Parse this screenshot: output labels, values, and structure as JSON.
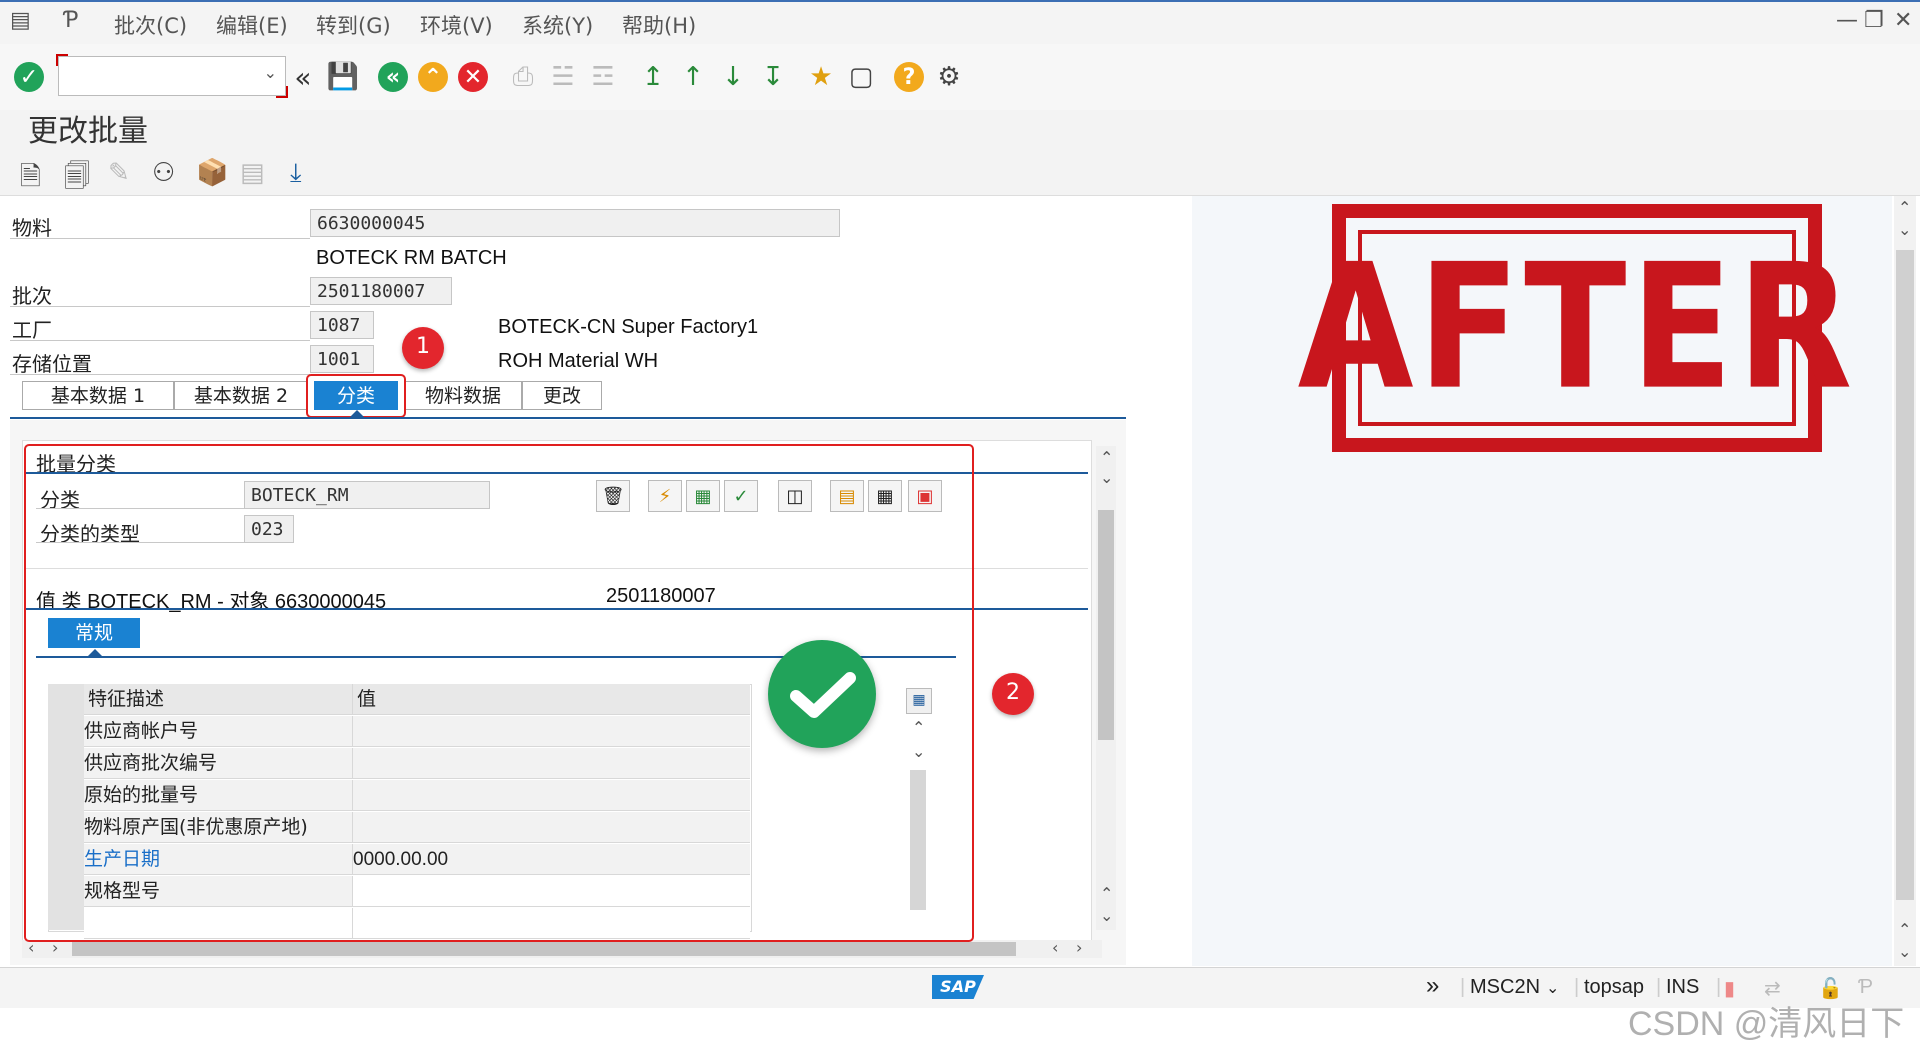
{
  "menubar": {
    "items": [
      "批次(C)",
      "编辑(E)",
      "转到(G)",
      "环境(V)",
      "系统(Y)",
      "帮助(H)"
    ]
  },
  "page_title": "更改批量",
  "header": {
    "material_label": "物料",
    "material_value": "6630000045",
    "material_desc": "BOTECK RM BATCH",
    "batch_label": "批次",
    "batch_value": "2501180007",
    "plant_label": "工厂",
    "plant_value": "1087",
    "plant_desc": "BOTECK-CN Super Factory1",
    "storage_label": "存储位置",
    "storage_value": "1001",
    "storage_desc": "ROH Material WH"
  },
  "tabs": [
    {
      "label": "基本数据 1",
      "active": false
    },
    {
      "label": "基本数据 2",
      "active": false
    },
    {
      "label": "分类",
      "active": true
    },
    {
      "label": "物料数据",
      "active": false
    },
    {
      "label": "更改",
      "active": false
    }
  ],
  "classification": {
    "section_title": "批量分类",
    "class_label": "分类",
    "class_value": "BOTECK_RM",
    "class_type_label": "分类的类型",
    "class_type_value": "023",
    "values_line_left": "值 类 BOTECK_RM - 对象 6630000045",
    "values_line_right": "2501180007",
    "subtab_label": "常规",
    "table_headers": [
      "特征描述",
      "值"
    ],
    "rows": [
      {
        "desc": "供应商帐户号",
        "value": "",
        "link": false
      },
      {
        "desc": "供应商批次编号",
        "value": "",
        "link": false
      },
      {
        "desc": "原始的批量号",
        "value": "",
        "link": false
      },
      {
        "desc": "物料原产国(非优惠原产地)",
        "value": "",
        "link": false
      },
      {
        "desc": "生产日期",
        "value": "0000.00.00",
        "link": true
      },
      {
        "desc": "规格型号",
        "value": "",
        "link": false
      },
      {
        "desc": "",
        "value": "",
        "link": false
      }
    ]
  },
  "annotations": {
    "badge1": "1",
    "badge2": "2",
    "stamp": "AFTER"
  },
  "statusbar": {
    "tcode": "MSC2N",
    "system": "topsap",
    "mode": "INS",
    "logo": "SAP"
  },
  "watermark": "CSDN @清风日下",
  "colors": {
    "accent": "#1a82d2",
    "annotation_red": "#e01f1f",
    "stamp_red": "#c8161d",
    "check_green": "#21a35a"
  }
}
